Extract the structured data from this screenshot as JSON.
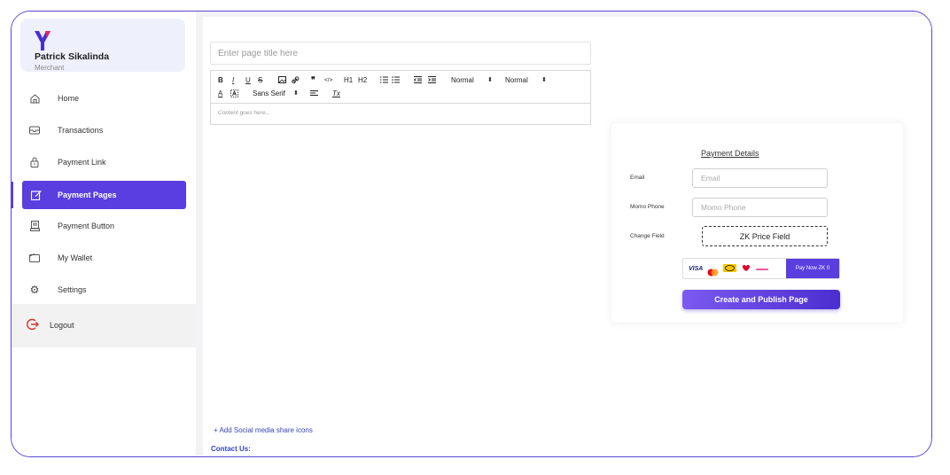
{
  "brand": {
    "logo": "Y-logo",
    "accent": "#5b3ee0"
  },
  "user": {
    "name": "Patrick Sikalinda",
    "role": "Merchant"
  },
  "sidebar": {
    "items": [
      {
        "label": "Home",
        "icon": "home-icon"
      },
      {
        "label": "Transactions",
        "icon": "inbox-icon"
      },
      {
        "label": "Payment Link",
        "icon": "lock-icon"
      },
      {
        "label": "Payment Pages",
        "icon": "edit-icon",
        "active": true
      },
      {
        "label": "Payment Button",
        "icon": "receipt-icon"
      },
      {
        "label": "My Wallet",
        "icon": "wallet-icon"
      },
      {
        "label": "Settings",
        "icon": "gear-icon"
      }
    ],
    "logout": "Logout"
  },
  "editor": {
    "title_placeholder": "Enter page title here",
    "toolbar": {
      "bold": "B",
      "italic": "I",
      "underline": "U",
      "strike": "S",
      "quote": "❞",
      "code": "</>",
      "h1": "H1",
      "h2": "H2",
      "size1": "Normal",
      "size2": "Normal",
      "font_color": "A",
      "font": "Sans Serif",
      "clear": "Tx",
      "dropdown": "⬍"
    },
    "content_placeholder": "Content goes here..."
  },
  "payment_card": {
    "title": "Payment Details",
    "email_label": "Email",
    "email_placeholder": "Email",
    "phone_label": "Momo Phone",
    "phone_placeholder": "Momo Phone",
    "change_label": "Change Field",
    "price_field": "ZK Price Field",
    "card_logos": [
      "VISA",
      "Mastercard",
      "MTN",
      "Airtel",
      "Zamtel"
    ],
    "visa_text": "VISA",
    "pay_now": "Pay Now ZK 0",
    "publish": "Create and Publish Page"
  },
  "footer": {
    "social": "+ Add Social media share icons",
    "contact": "Contact Us:"
  }
}
